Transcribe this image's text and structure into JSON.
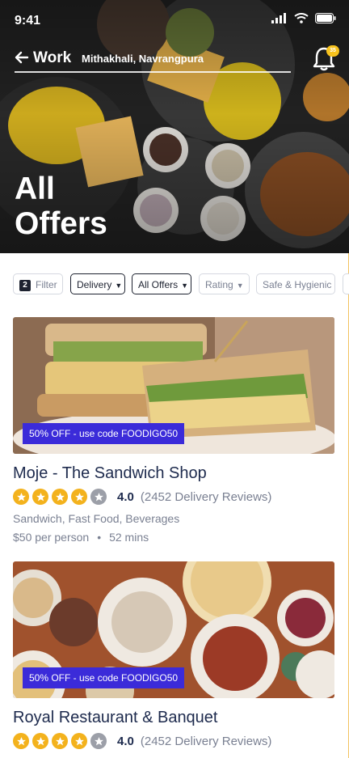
{
  "status_bar": {
    "time": "9:41"
  },
  "header": {
    "location_title": "Work",
    "location_subtitle": "Mithakhali, Navrangpura",
    "notification_count": "35",
    "page_title_line1": "All",
    "page_title_line2": "Offers"
  },
  "filters": {
    "filter_count": "2",
    "filter_label": "Filter",
    "chips": [
      {
        "label": "Delivery",
        "dropdown": true,
        "selected": true
      },
      {
        "label": "All Offers",
        "dropdown": true,
        "selected": true
      },
      {
        "label": "Rating",
        "dropdown": true,
        "selected": false
      },
      {
        "label": "Safe & Hygienic",
        "dropdown": false,
        "selected": false
      }
    ]
  },
  "restaurants": [
    {
      "offer": "50% OFF - use code FOODIGO50",
      "name": "Moje - The Sandwich Shop",
      "rating": "4.0",
      "stars_filled": 4,
      "reviews": "(2452 Delivery Reviews)",
      "cuisine": "Sandwich, Fast Food, Beverages",
      "price": "$50 per person",
      "time": "52 mins"
    },
    {
      "offer": "50% OFF - use code FOODIGO50",
      "name": "Royal Restaurant & Banquet",
      "rating": "4.0",
      "stars_filled": 4,
      "reviews": "(2452 Delivery Reviews)"
    }
  ],
  "colors": {
    "accent_offer": "#3b2bd9",
    "star": "#f3b21d",
    "star_off": "#9c9fa8",
    "title_text": "#1d2a4d",
    "badge": "#f7c21d"
  }
}
